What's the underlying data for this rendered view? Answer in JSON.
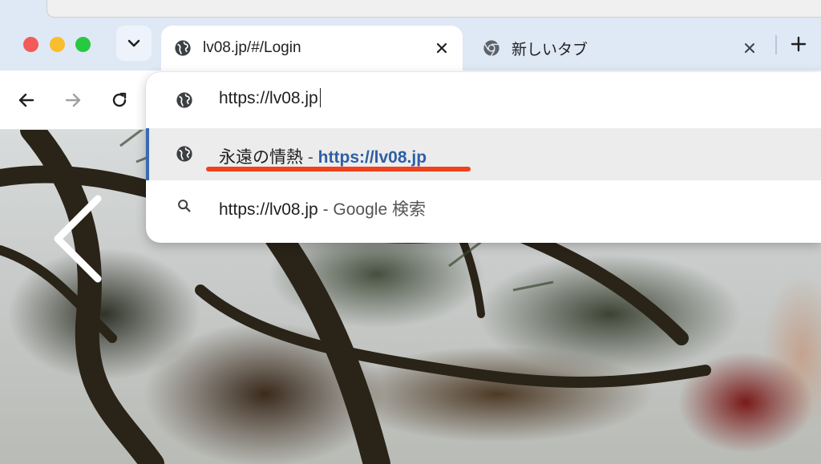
{
  "tabs": [
    {
      "title": "lv08.jp/#/Login",
      "icon": "globe-icon",
      "active": true
    },
    {
      "title": "新しいタブ",
      "icon": "chrome-icon",
      "active": false
    }
  ],
  "omnibox": {
    "input_value": "https://lv08.jp",
    "suggestions": [
      {
        "title": "永遠の情熱",
        "separator": " - ",
        "url": "https://lv08.jp",
        "icon": "globe-icon",
        "selected": true
      },
      {
        "query": "https://lv08.jp",
        "separator": " - ",
        "provider": "Google 検索",
        "icon": "search-icon",
        "selected": false
      }
    ]
  },
  "colors": {
    "selection_bar": "#3a6ab4",
    "url_text": "#2e5fa5",
    "annotation_underline": "#f0421c",
    "tabstrip_bg": "#dfe8f5"
  }
}
